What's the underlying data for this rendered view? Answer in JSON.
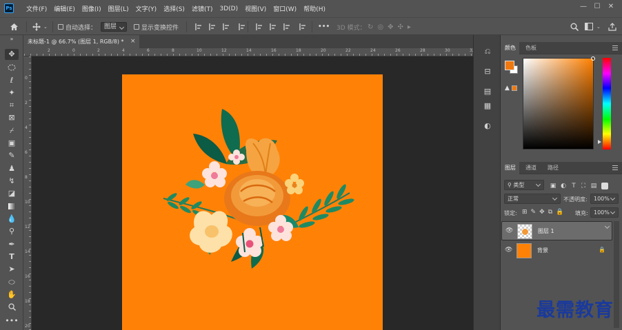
{
  "app": {
    "logo": "Ps",
    "accent": "#31a8ff"
  },
  "menu": [
    "文件(F)",
    "编辑(E)",
    "图像(I)",
    "图层(L)",
    "文字(Y)",
    "选择(S)",
    "滤镜(T)",
    "3D(D)",
    "视图(V)",
    "窗口(W)",
    "帮助(H)"
  ],
  "window_controls": {
    "minimize": "—",
    "restore": "☐",
    "close": "✕"
  },
  "options_bar": {
    "auto_select_label": "自动选择：",
    "auto_select_value": "图层",
    "show_transform_label": "显示变换控件",
    "mode_3d_label": "3D 模式：",
    "more": "•••"
  },
  "document": {
    "tab_title": "未标题-1 @ 66.7% (图层 1, RGB/8) *",
    "close": "×",
    "canvas_color": "#ff8207",
    "ruler_top_labels": [
      "2",
      "0",
      "2",
      "4",
      "6",
      "8",
      "10",
      "12",
      "14",
      "16",
      "18",
      "20",
      "22",
      "24",
      "26",
      "28",
      "30",
      "32"
    ],
    "ruler_left_labels": [
      "0",
      "2",
      "4",
      "6",
      "8",
      "10",
      "12",
      "14",
      "16",
      "18",
      "20"
    ]
  },
  "color_panel": {
    "tabs": [
      "颜色",
      "色板"
    ],
    "foreground": "#f0790f",
    "background": "#ffffff"
  },
  "layers_panel": {
    "tabs": [
      "图层",
      "通道",
      "路径"
    ],
    "filter_label": "类型",
    "blend_mode": "正常",
    "opacity_label": "不透明度:",
    "opacity_value": "100%",
    "lock_label": "锁定:",
    "fill_label": "填充:",
    "fill_value": "100%",
    "layers": [
      {
        "name": "图层 1",
        "selected": true
      },
      {
        "name": "背景",
        "selected": false,
        "locked": true
      }
    ]
  },
  "watermark": "最需教育"
}
